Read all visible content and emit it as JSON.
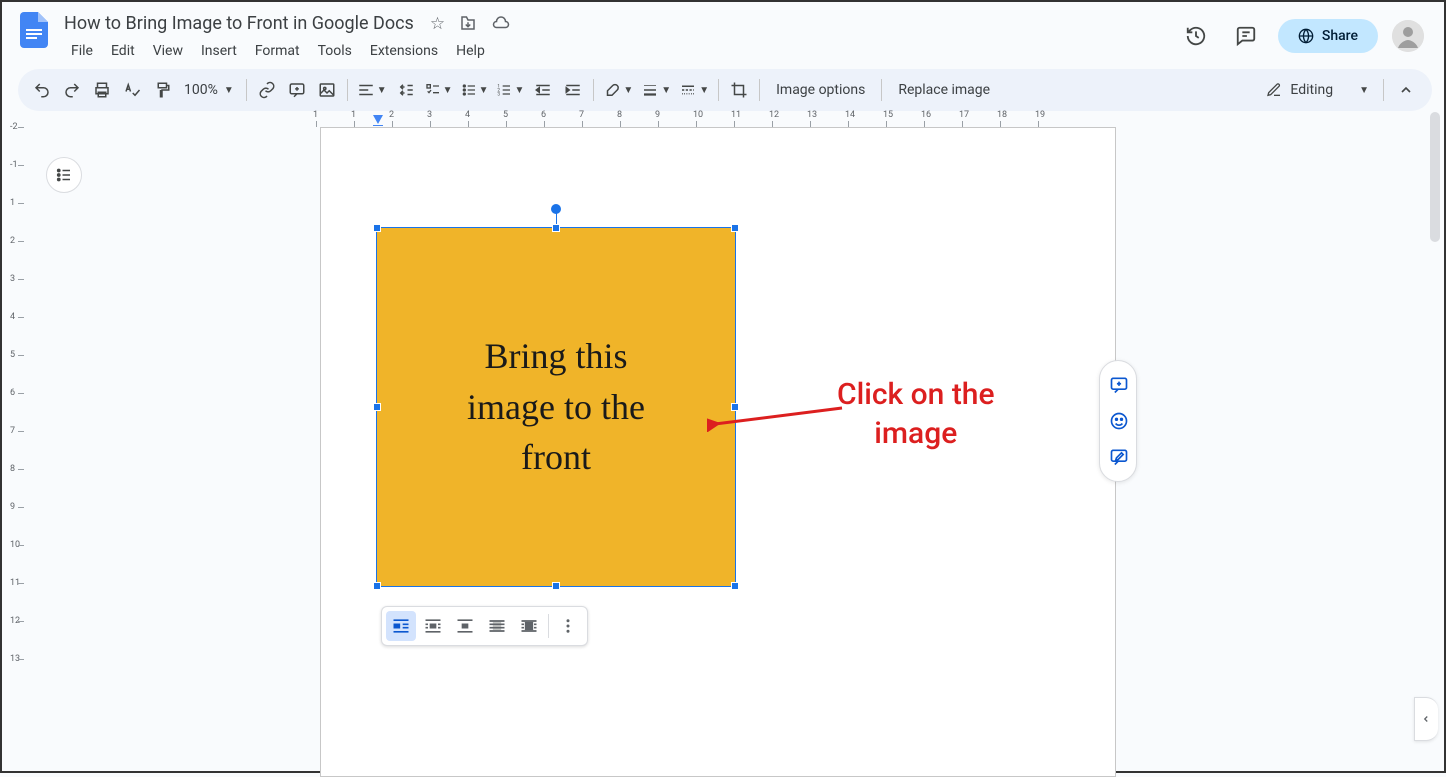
{
  "doc": {
    "title": "How to Bring Image to Front in Google Docs"
  },
  "menu": {
    "file": "File",
    "edit": "Edit",
    "view": "View",
    "insert": "Insert",
    "format": "Format",
    "tools": "Tools",
    "extensions": "Extensions",
    "help": "Help"
  },
  "toolbar": {
    "zoom": "100%",
    "image_options": "Image options",
    "replace_image": "Replace image",
    "editing": "Editing"
  },
  "share": {
    "label": "Share"
  },
  "image_text": {
    "l1": "Bring this",
    "l2": "image to the",
    "l3": "front"
  },
  "annotation": {
    "l1": "Click on the",
    "l2": "image"
  },
  "ruler_h": [
    1,
    1,
    2,
    3,
    4,
    5,
    6,
    7,
    8,
    9,
    10,
    11,
    12,
    13,
    14,
    15,
    16,
    17,
    18,
    19
  ],
  "ruler_v": [
    -2,
    -1,
    1,
    2,
    3,
    4,
    5,
    6,
    7,
    8,
    9,
    10,
    11,
    12,
    13
  ]
}
